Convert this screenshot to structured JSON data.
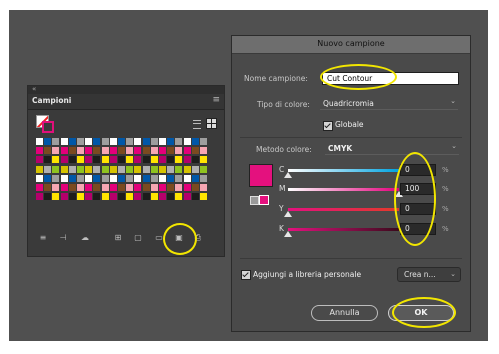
{
  "swatches_panel": {
    "tab_label": "Campioni",
    "collapse_glyph": "«",
    "menu_glyph": "≡",
    "swatch_colors": [
      "#ffffff",
      "#e21b2d",
      "#b0b0b0",
      "#000000",
      "#ffe400",
      "#f39200",
      "#e3007a",
      "#00a0e3",
      "#0057a8",
      "#3aaa35",
      "#8fc31f",
      "#6f2c91",
      "#b5006b",
      "#ff9ad2",
      "#7a4a20",
      "#00b1b0",
      "#9e9e9e",
      "#6d6d6d",
      "#d6c300",
      "#c10e24",
      "#1d1d1b",
      "#dadada",
      "#f6a6b2",
      "#8a1538"
    ]
  },
  "dialog": {
    "title": "Nuovo campione",
    "name_label": "Nome campione:",
    "name_value": "Cut Contour",
    "color_type_label": "Tipo di colore:",
    "color_type_value": "Quadricromia",
    "global_label": "Globale",
    "global_checked": true,
    "color_mode_label": "Metodo colore:",
    "color_mode_value": "CMYK",
    "preview_color": "#e4117e",
    "sliders": [
      {
        "label": "C",
        "value": "0",
        "unit": "%",
        "level": 0
      },
      {
        "label": "M",
        "value": "100",
        "unit": "%",
        "level": 100
      },
      {
        "label": "Y",
        "value": "0",
        "unit": "%",
        "level": 0
      },
      {
        "label": "K",
        "value": "0",
        "unit": "%",
        "level": 0
      }
    ],
    "add_to_library_label": "Aggiungi a libreria personale",
    "add_to_library_checked": true,
    "library_dropdown_value": "Crea n...",
    "cancel_label": "Annulla",
    "ok_label": "OK"
  },
  "annotation_color": "#f2e600"
}
